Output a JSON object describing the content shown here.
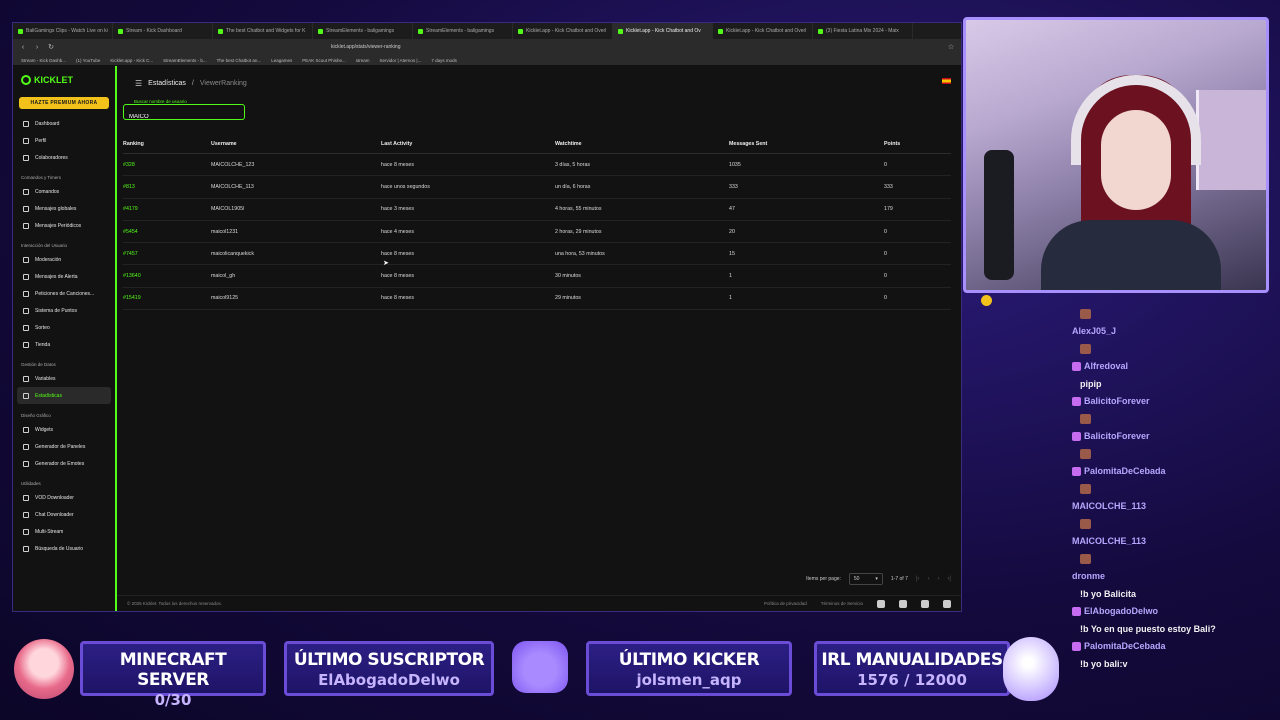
{
  "browser": {
    "tabs": [
      "BaliGamings Clips - Watch Live on ki",
      "Stream - Kick Dashboard",
      "The best Chatbot and Widgets for K",
      "StreamElements - baligamings",
      "StreamElements - baligamings",
      "Kicklet.app - Kick Chatbot and Overl",
      "Kicklet.app - Kick Chatbot and Ov",
      "Kicklet.app - Kick Chatbot and Overl",
      "(3) Fiesta Latina Mix 2024 - Maix"
    ],
    "active_tab": 6,
    "url": "kicklet.app/stats/viewer-ranking",
    "bookmarks": [
      "Stream - Kick Dashb...",
      "(1) YouTube",
      "Kicklet.app - Kick C...",
      "StreamElements - b...",
      "The best Chatbot an...",
      "Leagames",
      "PEAK Scout Phishe...",
      "stream",
      "Servidor | Aternos |...",
      "7 days mods"
    ]
  },
  "sidebar": {
    "logo": "KICKLET",
    "premium": "HAZTE PREMIUM AHORA",
    "top_items": [
      "Dashboard",
      "Perfil",
      "Colaboradores"
    ],
    "sec1": "Comandos y Timers",
    "sec1_items": [
      "Comandos",
      "Mensajes globales",
      "Mensajes Periódicos"
    ],
    "sec2": "Interacción del Usuario",
    "sec2_items": [
      "Moderación",
      "Mensajes de Alerta",
      "Peticiones de Canciones...",
      "Sistema de Puntos",
      "Sorteo",
      "Tienda"
    ],
    "sec3": "Gestión de Datos",
    "sec3_items": [
      "Variables",
      "Estadísticas"
    ],
    "sec4": "Diseño Gráfico",
    "sec4_items": [
      "Widgets",
      "Generador de Paneles",
      "Generador de Emotes"
    ],
    "sec5": "Utilidades",
    "sec5_items": [
      "VOD Downloader",
      "Chat Downloader",
      "Multi-Stream",
      "Búsqueda de Usuario"
    ]
  },
  "breadcrumb": {
    "root": "Estadísticas",
    "sep": "/",
    "current": "ViewerRanking"
  },
  "search": {
    "label": "Buscar nombre de usuario",
    "value": "MAICO"
  },
  "table": {
    "headers": [
      "Ranking",
      "Username",
      "Last Activity",
      "Watchtime",
      "Messages Sent",
      "Points"
    ],
    "rows": [
      [
        "#328",
        "MAICOLCHE_123",
        "hace 8 meses",
        "3 días, 5 horas",
        "1035",
        "0"
      ],
      [
        "#813",
        "MAICOLCHE_113",
        "hace unos segundos",
        "un día, 6 horas",
        "333",
        "333"
      ],
      [
        "#4179",
        "MAICOL1905l",
        "hace 3 meses",
        "4 horas, 55 minutos",
        "47",
        "179"
      ],
      [
        "#5454",
        "maicol1231",
        "hace 4 meses",
        "2 horas, 29 minutos",
        "20",
        "0"
      ],
      [
        "#7457",
        "maicolicanquekick",
        "hace 8 meses",
        "una hora, 53 minutos",
        "15",
        "0"
      ],
      [
        "#13640",
        "maicol_gh",
        "hace 8 meses",
        "30 minutos",
        "1",
        "0"
      ],
      [
        "#15419",
        "maicol9125",
        "hace 8 meses",
        "29 minutos",
        "1",
        "0"
      ]
    ]
  },
  "pager": {
    "label": "Items per page:",
    "per_page": "50",
    "range": "1-7 of 7"
  },
  "footer": {
    "copyright": "© 2025 Kicklet. Todos los derechos reservados.",
    "privacy": "Política de privacidad",
    "terms": "Términos de Servicio"
  },
  "chat": [
    {
      "user": "",
      "emote": true
    },
    {
      "user": "AlexJ05_J",
      "emote": false
    },
    {
      "user": "",
      "emote": true
    },
    {
      "user": "Alfredoval",
      "badge": true
    },
    {
      "text": "pipip"
    },
    {
      "user": "BalicitoForever",
      "badge": true
    },
    {
      "user": "",
      "emote": true
    },
    {
      "user": "BalicitoForever",
      "badge": true
    },
    {
      "user": "",
      "emote": true
    },
    {
      "user": "PalomitaDeCebada",
      "badge": true
    },
    {
      "user": "",
      "emote": true
    },
    {
      "user": "MAICOLCHE_113",
      "badge": false
    },
    {
      "user": "",
      "emote": true
    },
    {
      "user": "MAICOLCHE_113",
      "badge": false
    },
    {
      "user": "",
      "emote": true
    },
    {
      "user": "dronme",
      "badge": false
    },
    {
      "text": "!b yo Balicita"
    },
    {
      "user": "ElAbogadoDelwo",
      "badge": true
    },
    {
      "text": "!b Yo en que puesto estoy Bali?"
    },
    {
      "user": "PalomitaDeCebada",
      "badge": true
    },
    {
      "text": "!b yo bali:v"
    }
  ],
  "overlay": {
    "p1_title": "MINECRAFT SERVER",
    "p1_value": "0/30",
    "p2_title": "ÚLTIMO SUSCRIPTOR",
    "p2_value": "ElAbogadoDelwo",
    "p3_title": "ÚLTIMO KICKER",
    "p3_value": "jolsmen_aqp",
    "p4_title": "IRL MANUALIDADES",
    "p4_value": "1576 / 12000"
  },
  "colors": {
    "accent": "#53fc18",
    "premium": "#f2c21b",
    "overlay_border": "#6b4cd6",
    "chat_user": "#b7a6ff"
  }
}
